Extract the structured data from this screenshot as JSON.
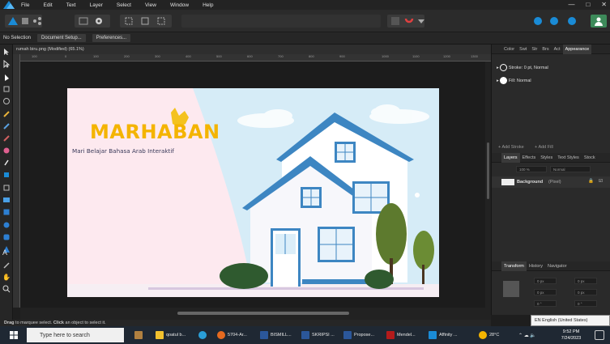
{
  "menu": {
    "items": [
      "File",
      "Edit",
      "Text",
      "Layer",
      "Select",
      "View",
      "Window",
      "Help"
    ]
  },
  "context": {
    "selection": "No Selection",
    "document_setup": "Document Setup...",
    "preferences": "Preferences..."
  },
  "document": {
    "tab_title": "rumah biru.png (Modified) (65.1%)"
  },
  "ruler_ticks": [
    "100",
    "0",
    "100",
    "200",
    "300",
    "400",
    "500",
    "600",
    "700",
    "800",
    "900",
    "1000",
    "1100",
    "1200",
    "1300",
    "1400"
  ],
  "artwork": {
    "title": "MARHABAN",
    "subtitle": "Mari Belajar Bahasa Arab Interaktif"
  },
  "status": {
    "prefix": "Drag",
    "text1": " to marquee select. ",
    "click": "Click",
    "text2": " an object to select it."
  },
  "panels": {
    "top_tabs": [
      "Color",
      "Swt",
      "Str",
      "Brs",
      "Act",
      "Appearance"
    ],
    "appearance": {
      "stroke": "Stroke: 0 pt,  Normal",
      "fill": "Fill:  Normal",
      "add_stroke": "Add Stroke",
      "add_fill": "Add Fill"
    },
    "mid_tabs": [
      "Layers",
      "Effects",
      "Styles",
      "Text Styles",
      "Stock"
    ],
    "layers": {
      "opacity": "100 %",
      "blend": "Normal",
      "layer_name": "Background",
      "layer_type": "(Pixel)"
    },
    "bottom_tabs": [
      "Transform",
      "History",
      "Navigator"
    ],
    "transform_fields": [
      "0 px",
      "0 px",
      "0 px",
      "0 px",
      "0 °",
      "0 °"
    ]
  },
  "taskbar": {
    "search_placeholder": "Type here to search",
    "apps": [
      "qoatul b...",
      "5704-Ar...",
      "BISMILL...",
      "SKRIPSI ...",
      "Propose...",
      "Mendel...",
      "Affinity ..."
    ],
    "weather": "28°C",
    "time": "9:52 PM",
    "date": "7/24/2023",
    "language": "EN English (United States)"
  },
  "colors": {
    "accent": "#1a8bd6",
    "house_blue": "#3d86c2",
    "title_yellow": "#f4b400",
    "tree_green": "#5d7a2e"
  }
}
